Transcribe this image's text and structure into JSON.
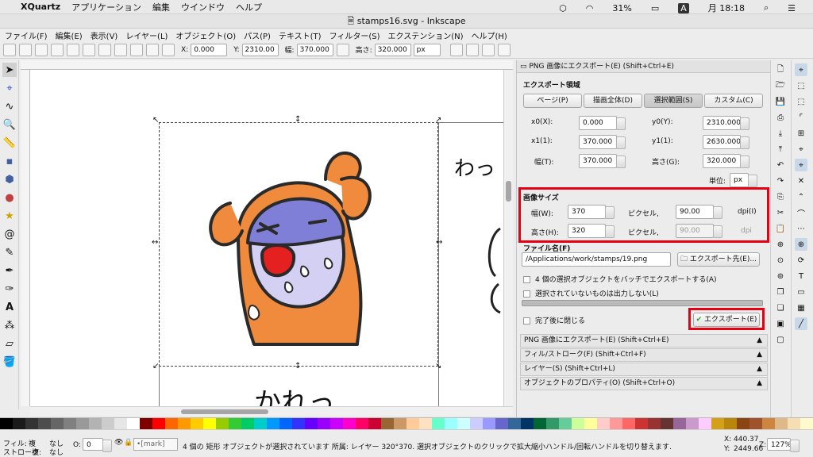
{
  "macbar": {
    "apple": "",
    "app": "XQuartz",
    "menus": [
      "アプリケーション",
      "編集",
      "ウインドウ",
      "ヘルプ"
    ],
    "battery": "31%",
    "input": "A",
    "clock": "月 18:18"
  },
  "window": {
    "title": "stamps16.svg - Inkscape"
  },
  "menubar": [
    "ファイル(F)",
    "編集(E)",
    "表示(V)",
    "レイヤー(L)",
    "オブジェクト(O)",
    "パス(P)",
    "テキスト(T)",
    "フィルター(S)",
    "エクステンション(N)",
    "ヘルプ(H)"
  ],
  "toolctrl": {
    "x_label": "X:",
    "x": "0.000",
    "y_label": "Y:",
    "y": "2310.00",
    "w_label": "幅:",
    "w": "370.000",
    "h_label": "高さ:",
    "h": "320.000",
    "unit": "px"
  },
  "export": {
    "panel_title": "PNG 画像にエクスポート(E) (Shift+Ctrl+E)",
    "area_heading": "エクスポート領域",
    "area_buttons": [
      "ページ(P)",
      "描画全体(D)",
      "選択範囲(S)",
      "カスタム(C)"
    ],
    "x0_label": "x0(X):",
    "x0": "0.000",
    "y0_label": "y0(Y):",
    "y0": "2310.000",
    "x1_label": "x1(1):",
    "x1": "370.000",
    "y1_label": "y1(1):",
    "y1": "2630.000",
    "w_label": "幅(T):",
    "w": "370.000",
    "h_label": "高さ(G):",
    "h": "320.000",
    "unit_label": "単位:",
    "unit": "px",
    "size_heading": "画像サイズ",
    "width_label": "幅(W):",
    "width_px": "370",
    "pixels_label": "ピクセル,",
    "dpi_x": "90.00",
    "dpi_label": "dpi(I)",
    "height_label": "高さ(H):",
    "height_px": "320",
    "pixels_label2": "ピクセル,",
    "dpi_y": "90.00",
    "dpi_label2": "dpi",
    "filename_heading": "ファイル名(F)",
    "filename": "/Applications/work/stamps/19.png",
    "export_as": "エクスポート先(E)...",
    "batch": "4 個の選択オブジェクトをバッチでエクスポートする(A)",
    "hide_unselected": "選択されていないものは出力しない(L)",
    "close_after": "完了後に閉じる",
    "export_button": "エクスポート(E)"
  },
  "collapsed_panels": [
    "PNG 画像にエクスポート(E) (Shift+Ctrl+E)",
    "フィル/ストローク(F) (Shift+Ctrl+F)",
    "レイヤー(S) (Shift+Ctrl+L)",
    "オブジェクトのプロパティ(O) (Shift+Ctrl+O)"
  ],
  "canvas_text": {
    "right_top": "わっ",
    "bottom": "かれっ"
  },
  "status": {
    "fill_label": "フィル:",
    "fill_value": "なし",
    "fill_mark": "複",
    "stroke_label": "ストローク:",
    "stroke_value": "なし",
    "stroke_mark": "複",
    "opacity_label": "O:",
    "opacity": "0",
    "layer": "•[mark]",
    "message": "4 個の 矩形 オブジェクトが選択されています 所属: レイヤー 320°370. 選択オブジェクトのクリックで拡大縮小ハンドル/回転ハンドルを切り替えます.",
    "x_label": "X:",
    "x": "440.37",
    "y_label": "Y:",
    "y": "2449.66",
    "zoom_label": "Z:",
    "zoom": "127%"
  },
  "colors": {
    "accent_red": "#e60012",
    "character_orange": "#f08a3c",
    "face_purple": "#7f7fd8"
  }
}
